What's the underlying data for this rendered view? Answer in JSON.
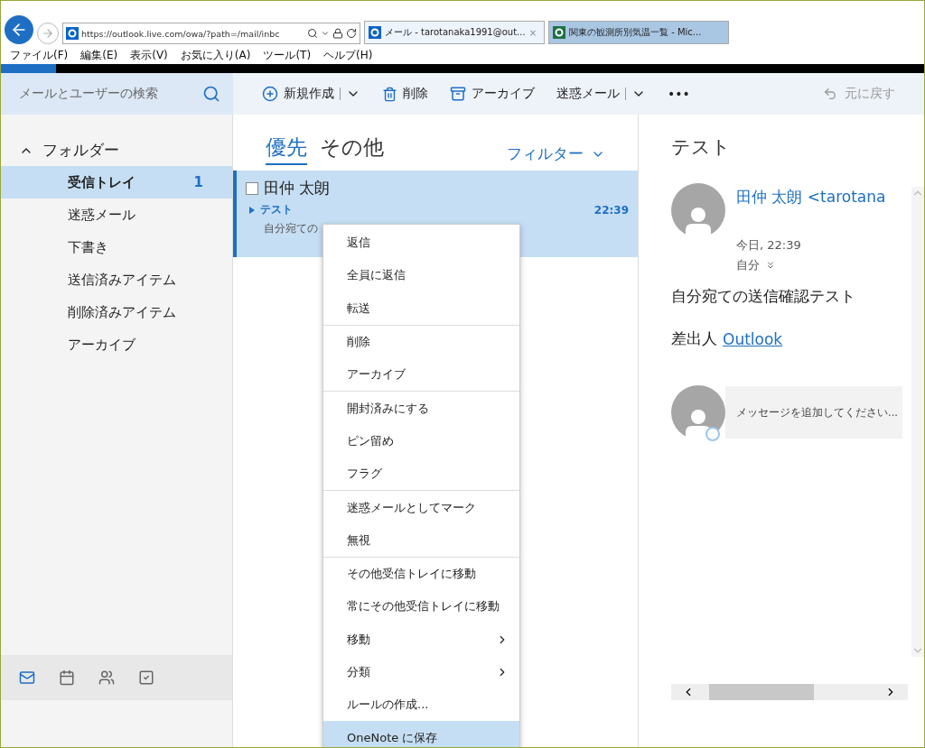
{
  "browser": {
    "address": "https://outlook.live.com/owa/?path=/mail/inbc",
    "tabs": [
      {
        "label": "メール - tarotanaka1991@out...",
        "kind": "outlook",
        "selected": true,
        "close": "×"
      },
      {
        "label": "関東の観測所別気温一覧 - Mic...",
        "kind": "excel",
        "selected": false
      }
    ],
    "progress": {
      "level": 0.06
    },
    "menu": [
      "ファイル(F)",
      "編集(E)",
      "表示(V)",
      "お気に入り(A)",
      "ツール(T)",
      "ヘルプ(H)"
    ]
  },
  "search": {
    "placeholder": "メールとユーザーの検索"
  },
  "toolbar": [
    {
      "label": "新規作成",
      "kind": "new",
      "dropdown": true
    },
    {
      "label": "削除",
      "kind": "delete",
      "dropdown": false
    },
    {
      "label": "アーカイブ",
      "kind": "archive",
      "dropdown": false
    },
    {
      "label": "迷惑メール",
      "kind": "plain",
      "dropdown": true
    },
    {
      "label": "•••",
      "kind": "plain",
      "dropdown": false
    }
  ],
  "undo": {
    "label": "元に戻す",
    "disabled": true
  },
  "folders": {
    "title": "フォルダー",
    "expanded": true,
    "items": [
      {
        "label": "受信トレイ",
        "count": "1",
        "selected": true
      },
      {
        "label": "迷惑メール",
        "selected": false
      },
      {
        "label": "下書き",
        "selected": false
      },
      {
        "label": "送信済みアイテム",
        "selected": false
      },
      {
        "label": "削除済みアイテム",
        "selected": false
      },
      {
        "label": "アーカイブ",
        "selected": false
      }
    ]
  },
  "nav": [
    {
      "kind": "mail",
      "selected": true
    },
    {
      "kind": "calendar",
      "selected": false
    },
    {
      "kind": "people",
      "selected": false
    },
    {
      "kind": "tasks",
      "selected": false
    }
  ],
  "list_tabs": [
    {
      "label": "優先",
      "selected": true
    },
    {
      "label": "その他",
      "selected": false
    }
  ],
  "filter": "フィルター",
  "messages": [
    {
      "sender": "田仲 太朗",
      "subject": "テスト",
      "time": "22:39",
      "preview": "自分宛ての",
      "selected": true,
      "checked": false
    }
  ],
  "reading": {
    "subject": "テスト",
    "from": "田仲 太朗 <tarotana",
    "date": "今日, 22:39",
    "to": "自分",
    "body": "自分宛ての送信確認テスト",
    "signature": "差出人",
    "signature_link": "Outlook",
    "reply_placeholder": "メッセージを追加してください..."
  },
  "context_menu": [
    [
      {
        "label": "返信",
        "submenu": false,
        "selected": false
      },
      {
        "label": "全員に返信",
        "submenu": false,
        "selected": false
      },
      {
        "label": "転送",
        "submenu": false,
        "selected": false
      }
    ],
    [
      {
        "label": "削除",
        "submenu": false,
        "selected": false
      },
      {
        "label": "アーカイブ",
        "submenu": false,
        "selected": false
      }
    ],
    [
      {
        "label": "開封済みにする",
        "submenu": false,
        "selected": false
      },
      {
        "label": "ピン留め",
        "submenu": false,
        "selected": false
      },
      {
        "label": "フラグ",
        "submenu": false,
        "selected": false
      }
    ],
    [
      {
        "label": "迷惑メールとしてマーク",
        "submenu": false,
        "selected": false
      },
      {
        "label": "無視",
        "submenu": false,
        "selected": false
      }
    ],
    [
      {
        "label": "その他受信トレイに移動",
        "submenu": false,
        "selected": false
      },
      {
        "label": "常にその他受信トレイに移動",
        "submenu": false,
        "selected": false
      },
      {
        "label": "移動",
        "submenu": true,
        "selected": false
      },
      {
        "label": "分類",
        "submenu": true,
        "selected": false
      },
      {
        "label": "ルールの作成...",
        "submenu": false,
        "selected": false
      },
      {
        "label": "OneNote に保存",
        "submenu": false,
        "selected": true
      }
    ]
  ]
}
